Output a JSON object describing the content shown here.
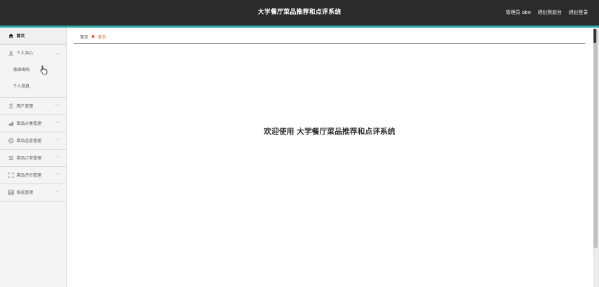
{
  "header": {
    "title": "大学餐厅菜品推荐和点评系统",
    "admin_label": "管理员 abo",
    "back_to_front": "退出到前台",
    "logout": "退出登录"
  },
  "sidebar": {
    "home": "首页",
    "personal_center": {
      "label": "个人中心",
      "children": [
        "修改密码",
        "个人信息"
      ]
    },
    "items": [
      {
        "label": "用户管理",
        "icon": "user-icon"
      },
      {
        "label": "菜品分类管理",
        "icon": "chart-icon"
      },
      {
        "label": "菜品信息管理",
        "icon": "info-icon"
      },
      {
        "label": "菜品订单管理",
        "icon": "list-icon"
      },
      {
        "label": "菜品评价管理",
        "icon": "frame-icon"
      },
      {
        "label": "系统管理",
        "icon": "grid-icon"
      }
    ]
  },
  "breadcrumb": {
    "root": "首页",
    "current": "首页"
  },
  "main": {
    "welcome": "欢迎使用 大学餐厅菜品推荐和点评系统"
  },
  "colors": {
    "header_bg": "#2b2b2b",
    "accent": "#2aa8a8",
    "breadcrumb_active": "#e55c30"
  }
}
